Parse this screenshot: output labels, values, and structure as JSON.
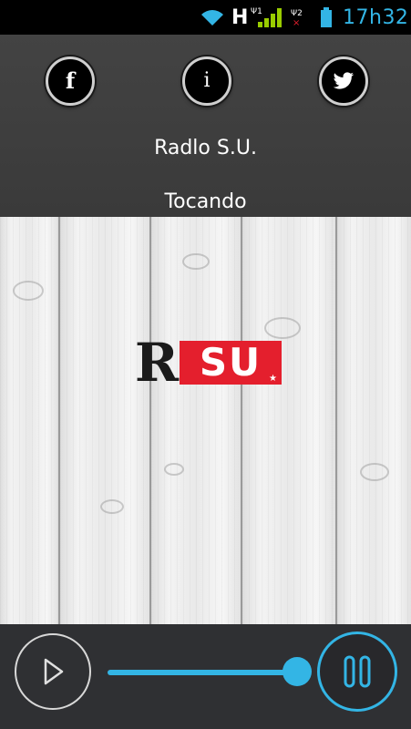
{
  "status_bar": {
    "time": "17h32",
    "network_type": "H",
    "colors": {
      "icons": "#33b5e5"
    },
    "icons": [
      "wifi-icon",
      "signal-icon",
      "sim2-no-signal-icon",
      "battery-icon"
    ]
  },
  "header": {
    "buttons": [
      {
        "icon": "facebook-icon",
        "glyph": "f"
      },
      {
        "icon": "info-icon",
        "glyph": "i"
      },
      {
        "icon": "twitter-icon"
      }
    ],
    "station_name": "Radlo S.U.",
    "status": "Tocando"
  },
  "logo": {
    "letter": "R",
    "highlight": "SU",
    "colors": {
      "dark": "#1b1b1b",
      "accent": "#e41f2d"
    }
  },
  "player": {
    "play_icon": "play-icon",
    "pause_icon": "pause-icon",
    "volume_level": 0.95,
    "accent_color": "#33b5e5"
  }
}
